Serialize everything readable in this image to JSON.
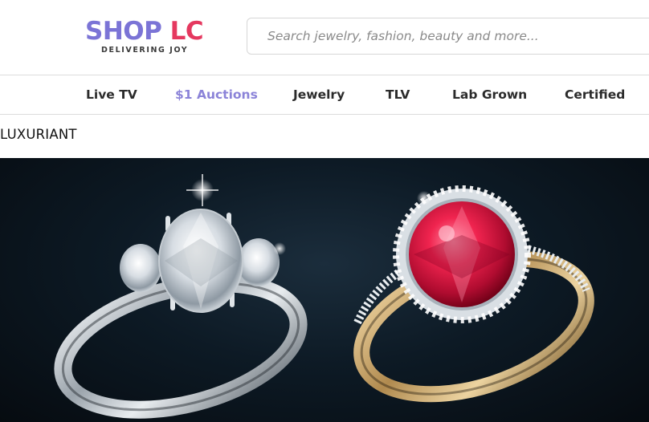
{
  "brand": {
    "name_part1": "SHOP",
    "name_part2": "LC",
    "tagline": "DELIVERING JOY",
    "colors": {
      "primary": "#7b74d6",
      "secondary": "#e5385f"
    }
  },
  "search": {
    "placeholder": "Search jewelry, fashion, beauty and more...",
    "value": ""
  },
  "nav": {
    "items": [
      {
        "label": "Live TV"
      },
      {
        "label": "$1 Auctions",
        "color": "#8b83d8"
      },
      {
        "label": "Jewelry"
      },
      {
        "label": "TLV"
      },
      {
        "label": "Lab Grown"
      },
      {
        "label": "Certified"
      }
    ]
  },
  "section": {
    "title": "LUXURIANT"
  },
  "banner": {
    "background": "#0d1a25",
    "image_subject": [
      "diamond-ring",
      "ruby-halo-ring"
    ]
  }
}
